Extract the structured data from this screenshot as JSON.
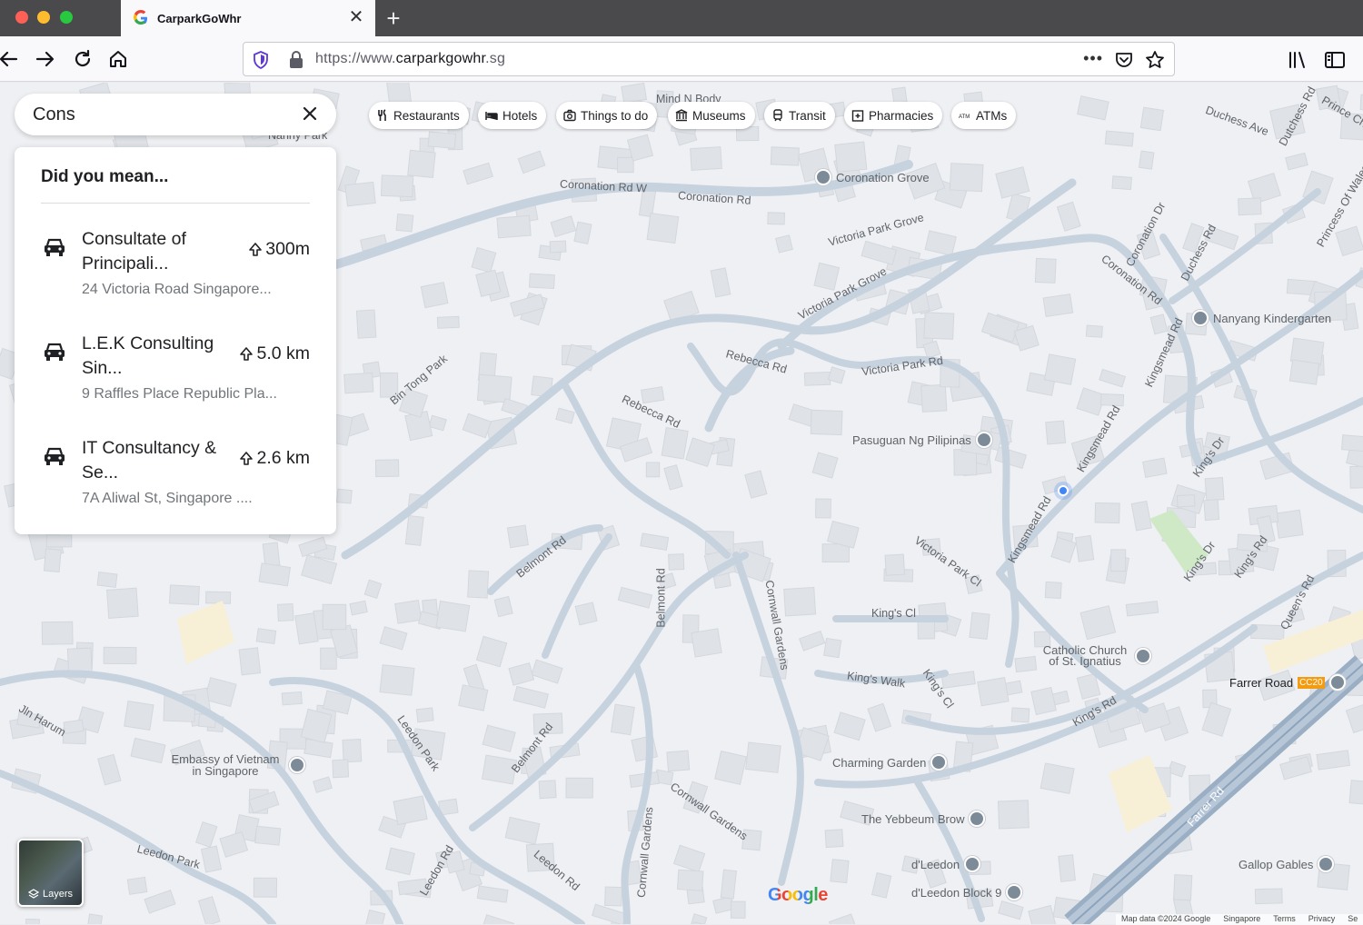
{
  "browser": {
    "tab_title": "CarparkGoWhr",
    "url_prefix": "https://www.",
    "url_domain": "carparkgowhr",
    "url_suffix": ".sg",
    "more_label": "•••"
  },
  "search": {
    "value": "Cons"
  },
  "results": {
    "title": "Did you mean...",
    "items": [
      {
        "name": "Consultate of Principali...",
        "distance": "300m",
        "address": "24 Victoria Road Singapore...",
        "icon": "car-icon"
      },
      {
        "name": "L.E.K Consulting Sin...",
        "distance": "5.0 km",
        "address": "9 Raffles Place Republic Pla...",
        "icon": "car-icon"
      },
      {
        "name": "IT Consultancy & Se...",
        "distance": "2.6 km",
        "address": "7A Aliwal St, Singapore ....",
        "icon": "car-icon"
      }
    ]
  },
  "chips": [
    {
      "label": "Restaurants",
      "icon": "fork-knife-icon"
    },
    {
      "label": "Hotels",
      "icon": "bed-icon"
    },
    {
      "label": "Things to do",
      "icon": "camera-icon"
    },
    {
      "label": "Museums",
      "icon": "museum-icon"
    },
    {
      "label": "Transit",
      "icon": "train-icon"
    },
    {
      "label": "Pharmacies",
      "icon": "pharmacy-icon"
    },
    {
      "label": "ATMs",
      "icon": "atm-icon"
    }
  ],
  "map": {
    "street_labels": [
      "Coronation Rd W",
      "Coronation Rd",
      "Victoria Park Grove",
      "Victoria Park Grove",
      "Victoria Park Rd",
      "Rebecca Rd",
      "Rebecca Rd",
      "Bin Tong Park",
      "Belmont Rd",
      "Belmont Rd",
      "Belmont Rd",
      "Cornwall Gardens",
      "Cornwall Gardens",
      "Cornwall Gardens",
      "Leedon Park",
      "Leedon Park",
      "Leedon Rd",
      "Leedon Rd",
      "Kingsmead Rd",
      "Kingsmead Rd",
      "Kingsmead Rd",
      "King's Rd",
      "King's Rd",
      "King's Cl",
      "King's Cl",
      "King's Walk",
      "Victoria Park Cl",
      "Coronation Dr",
      "Coronation Rd",
      "Duchess Rd",
      "Duchess Ave",
      "Dutchess Rd",
      "Queen's Rd",
      "Farrer Rd",
      "Jln Harum",
      "Nanny Park",
      "Mind N Body",
      "Coronation Dr",
      "Princess Of Wales Rd",
      "King's Dr",
      "King's Dr",
      "Prince Ch"
    ],
    "pois": [
      {
        "name": "Coronation Grove"
      },
      {
        "name": "Nanyang Kindergarten"
      },
      {
        "name": "Pasuguan Ng Pilipinas"
      },
      {
        "name": "Catholic Church of St. Ignatius"
      },
      {
        "name": "Farrer Road"
      },
      {
        "name": "Embassy of Vietnam in Singapore"
      },
      {
        "name": "Charming Garden"
      },
      {
        "name": "The Yebbeum Brow"
      },
      {
        "name": "d'Leedon"
      },
      {
        "name": "d'Leedon Block 9"
      },
      {
        "name": "Gallop Gables"
      }
    ],
    "station_code": "CC20",
    "layers_label": "Layers",
    "google_logo": "Google",
    "attribution": [
      "Map data ©2024 Google",
      "Singapore",
      "Terms",
      "Privacy",
      "Se"
    ]
  },
  "colors": {
    "map_bg": "#eef0f3",
    "road": "#c2cfdc",
    "building": "#dfe2e7",
    "park": "#cfe9c7",
    "location": "#4285f4"
  }
}
